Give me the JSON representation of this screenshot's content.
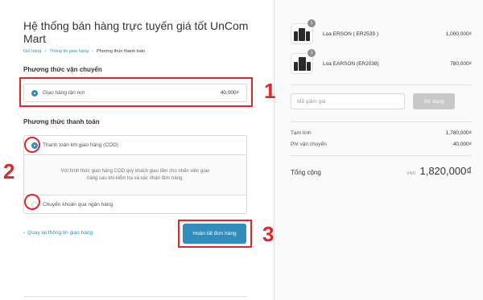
{
  "header": {
    "title": "Hệ thống bán hàng trực tuyến giá tốt UnCom Mart"
  },
  "breadcrumb": [
    {
      "label": "Giỏ hàng"
    },
    {
      "label": "Thông tin giao hàng"
    },
    {
      "label": "Phương thức thanh toán"
    }
  ],
  "shipping": {
    "heading": "Phương thức vận chuyển",
    "option_label": "Giao hàng tận nơi",
    "option_price": "40,000₫"
  },
  "payment": {
    "heading": "Phương thức thanh toán",
    "options": [
      {
        "label": "Thanh toán khi giao hàng (COD)",
        "selected": true
      },
      {
        "label": "Chuyển khoản qua ngân hàng",
        "selected": false
      }
    ],
    "cod_description": "Với hình thức giao hàng COD quý khách giao tiền cho nhân viên giao hàng sau khi kiểm tra và xác nhận đơn hàng."
  },
  "footer": {
    "back_link": "Quay lại thông tin giao hàng",
    "back_icon": "chevron-left-icon",
    "complete_button": "Hoàn tất đơn hàng"
  },
  "annotations": {
    "step1": "1",
    "step2": "2",
    "step3": "3",
    "color": "#e0262b"
  },
  "cart": {
    "items": [
      {
        "qty": "1",
        "name": "Loa ERSON ( ER2539 )",
        "price": "1,000,000₫"
      },
      {
        "qty": "1",
        "name": "Loa EARSON (ER2038)",
        "price": "780,000₫"
      }
    ],
    "discount_placeholder": "Mã giảm giá",
    "discount_button": "Sử dụng",
    "subtotal_label": "Tạm tính",
    "subtotal_value": "1,780,000₫",
    "shipping_label": "Phí vận chuyển",
    "shipping_value": "40,000₫",
    "total_label": "Tổng cộng",
    "total_currency": "VND",
    "total_value": "1,820,000₫"
  },
  "colors": {
    "accent": "#338dbc",
    "disabled_button": "#c8c8c8"
  }
}
